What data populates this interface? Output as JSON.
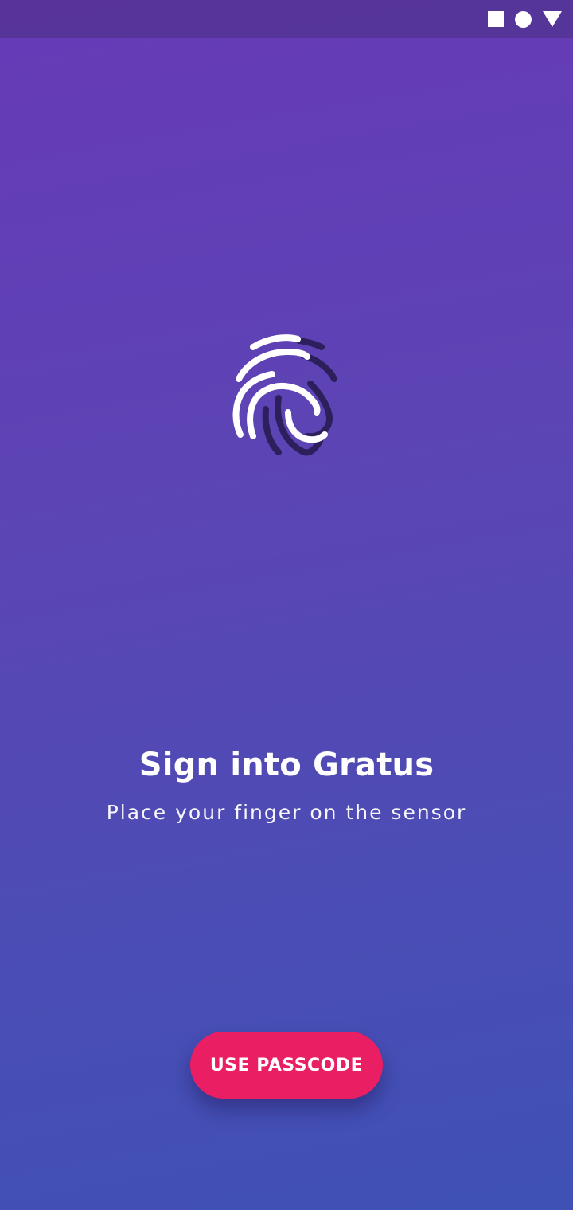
{
  "status_bar": {
    "icons": [
      "square-icon",
      "circle-icon",
      "triangle-icon"
    ]
  },
  "hero": {
    "icon": "fingerprint-icon"
  },
  "content": {
    "title": "Sign into Gratus",
    "subtitle": "Place your finger on the sensor"
  },
  "actions": {
    "passcode_label": "USE PASSCODE"
  },
  "colors": {
    "gradient_top": "#673ab7",
    "gradient_bottom": "#3f51b5",
    "accent": "#e91e63",
    "fingerprint_light": "#ffffff",
    "fingerprint_dark": "#2d1f5c"
  }
}
